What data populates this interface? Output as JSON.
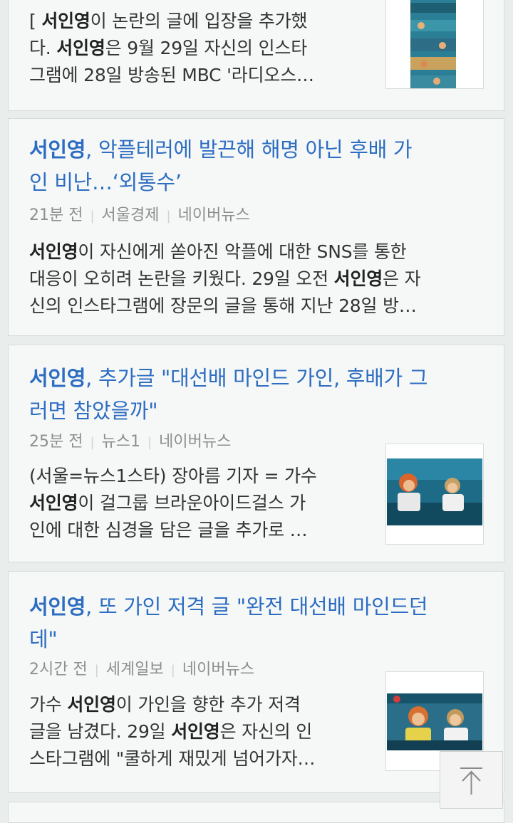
{
  "articles": [
    {
      "desc_lines": [
        {
          "pre": "[ ",
          "bold": "서인영",
          "post": "이 논란의 글에 입장을 추가했"
        },
        {
          "pre": "다. ",
          "bold": "서인영",
          "post": "은 9월 29일 자신의 인스타"
        },
        {
          "pre": "그램에 28일 방송된 MBC '라디오스…",
          "bold": "",
          "post": ""
        }
      ]
    },
    {
      "title_bold": "서인영",
      "title_line1": ", 악플테러에 발끈해 해명 아닌 후배 가",
      "title_line2": "인 비난…‘외통수’",
      "time": "21분 전",
      "source": "서울경제",
      "portal": "네이버뉴스",
      "desc_lines": [
        {
          "pre": "",
          "bold": "서인영",
          "post": "이 자신에게 쏟아진 악플에 대한 SNS를 통한"
        },
        {
          "pre": "대응이 오히려 논란을 키웠다. 29일 오전 ",
          "bold": "서인영",
          "post": "은 자"
        },
        {
          "pre": "신의 인스타그램에 장문의 글을 통해 지난 28일 방…",
          "bold": "",
          "post": ""
        }
      ]
    },
    {
      "title_bold": "서인영",
      "title_line1": ", 추가글 \"대선배 마인드 가인, 후배가 그",
      "title_line2": "러면 참았을까\"",
      "time": "25분 전",
      "source": "뉴스1",
      "portal": "네이버뉴스",
      "desc_lines": [
        {
          "pre": "(서울=뉴스1스타) 장아름 기자 = 가수",
          "bold": "",
          "post": ""
        },
        {
          "pre": "",
          "bold": "서인영",
          "post": "이 걸그룹 브라운아이드걸스 가"
        },
        {
          "pre": "인에 대한 심경을 담은 글을 추가로 …",
          "bold": "",
          "post": ""
        }
      ]
    },
    {
      "title_bold": "서인영",
      "title_line1": ", 또 가인 저격 글 \"완전 대선배 마인드던",
      "title_line2": "데\"",
      "time": "2시간 전",
      "source": "세계일보",
      "portal": "네이버뉴스",
      "desc_lines": [
        {
          "pre": "가수 ",
          "bold": "서인영",
          "post": "이 가인을 향한 추가 저격"
        },
        {
          "pre": "글을 남겼다. 29일 ",
          "bold": "서인영",
          "post": "은 자신의 인"
        },
        {
          "pre": "스타그램에 \"쿨하게 재밌게 넘어가자…",
          "bold": "",
          "post": ""
        }
      ]
    }
  ],
  "colors": {
    "title": "#2d6dc2",
    "meta": "#8c8f8e",
    "text": "#333333",
    "card": "#f6f8f7"
  },
  "icons": {
    "scroll_top": "arrow-up-to-top-icon"
  }
}
